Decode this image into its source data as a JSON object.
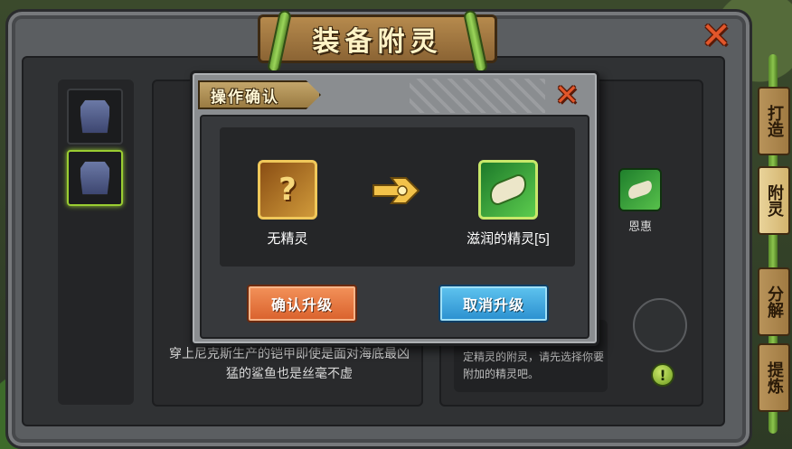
{
  "window": {
    "title": "装备附灵",
    "close_icon": "close-icon"
  },
  "side_tabs": [
    {
      "label": "打造",
      "active": false
    },
    {
      "label": "附灵",
      "active": true
    },
    {
      "label": "分解",
      "active": false
    },
    {
      "label": "提炼",
      "active": false
    }
  ],
  "left_panel": {
    "description": "穿上尼克斯生产的铠甲即使是面对海底最凶猛的鲨鱼也是丝毫不虚"
  },
  "right_panel": {
    "spirit_label": "恩惠",
    "hint": "定精灵的附灵，请先选择你要附加的精灵吧。",
    "alert_glyph": "!"
  },
  "dialog": {
    "title": "操作确认",
    "from_item": {
      "label": "无精灵",
      "glyph": "?"
    },
    "to_item": {
      "label": "滋润的精灵[5]"
    },
    "confirm_label": "确认升级",
    "cancel_label": "取消升级"
  },
  "colors": {
    "confirm_button": "#d9612c",
    "cancel_button": "#2a8fcf",
    "title_text": "#fff3c6",
    "close_x": "#e2562a"
  }
}
